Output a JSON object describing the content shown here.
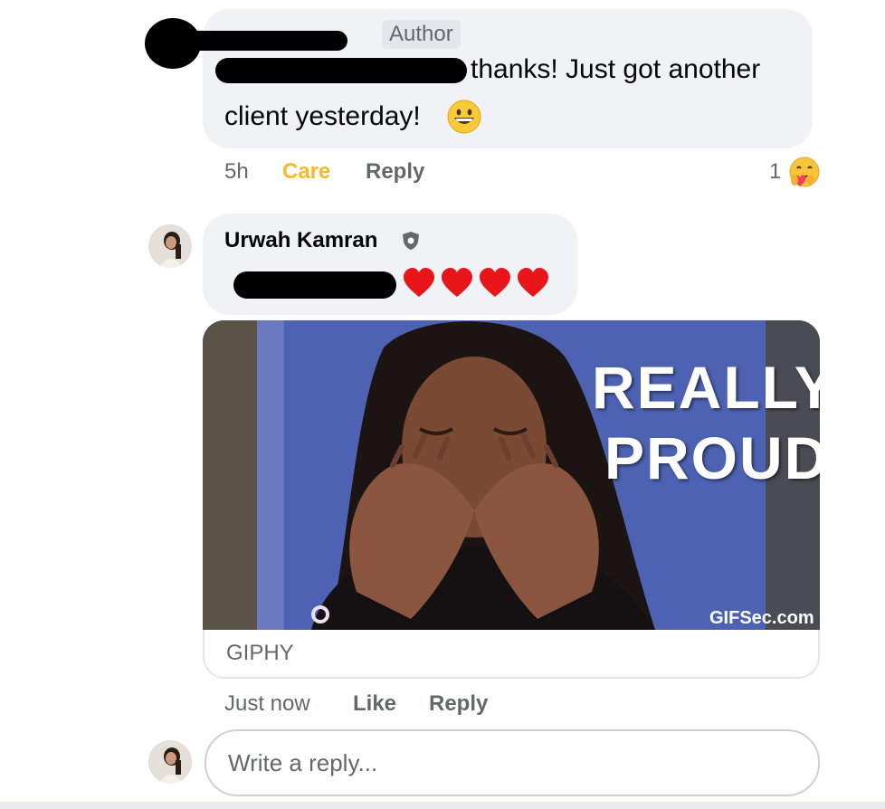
{
  "comment1": {
    "author_badge": "Author",
    "text_line1": "thanks! Just got another",
    "text_line2": "client yesterday!",
    "emoji": "grinning-face",
    "time": "5h",
    "reaction_label": "Care",
    "reply_label": "Reply",
    "reaction_count": "1",
    "reaction_icon": "care-emoji",
    "care_color": "#f7b928"
  },
  "comment2": {
    "author_name": "Urwah Kamran",
    "author_icon": "shield-icon",
    "hearts": [
      "heart",
      "heart",
      "heart",
      "heart"
    ],
    "heart_color": "#e8151a",
    "gif_caption_line1": "REALLY",
    "gif_caption_line2": "PROUD",
    "gif_watermark": "GIFSec.com",
    "gif_source": "GIPHY",
    "time": "Just now",
    "like_label": "Like",
    "reply_label": "Reply"
  },
  "reply_input": {
    "placeholder": "Write a reply..."
  }
}
